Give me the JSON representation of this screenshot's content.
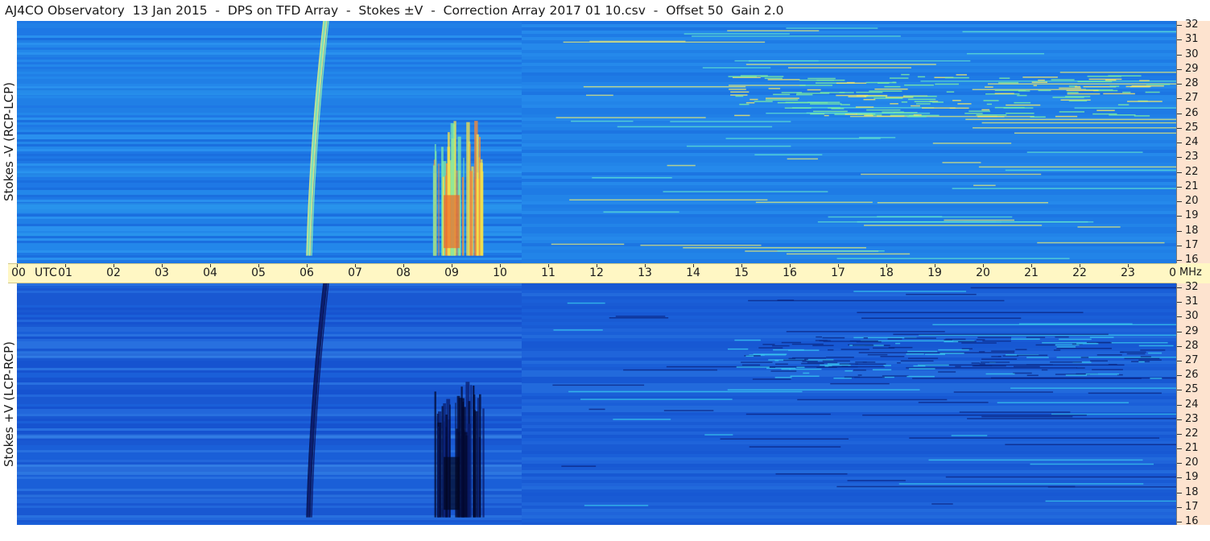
{
  "header": {
    "title": "AJ4CO Observatory  13 Jan 2015  -  DPS on TFD Array  -  Stokes ±V  -  Correction Array 2017 01 10.csv  -  Offset 50  Gain 2.0"
  },
  "panels": {
    "top_label": "Stokes -V (RCP-LCP)",
    "bottom_label": "Stokes +V (LCP-RCP)"
  },
  "time_axis": {
    "unit_label": "UTC",
    "ticks": [
      "00",
      "01",
      "02",
      "03",
      "04",
      "05",
      "06",
      "07",
      "08",
      "09",
      "10",
      "11",
      "12",
      "13",
      "14",
      "15",
      "16",
      "17",
      "18",
      "19",
      "20",
      "21",
      "22",
      "23",
      "00"
    ]
  },
  "freq_axis": {
    "unit_label": "MHz",
    "ticks": [
      "32",
      "31",
      "30",
      "29",
      "28",
      "27",
      "26",
      "25",
      "24",
      "23",
      "22",
      "21",
      "20",
      "19",
      "18",
      "17",
      "16"
    ]
  },
  "colors": {
    "top_background": "#1f7ee6",
    "bottom_background": "#1a5fd8",
    "time_bar": "#fff7c4",
    "freq_bar": "#fde3cf"
  },
  "chart_data": {
    "type": "heatmap",
    "title": "AJ4CO Observatory  13 Jan 2015  -  DPS on TFD Array  -  Stokes ±V  -  Correction Array 2017 01 10.csv  -  Offset 50  Gain 2.0",
    "xlabel": "UTC",
    "ylabel": "MHz",
    "xlim": [
      0,
      24
    ],
    "ylim": [
      16,
      32
    ],
    "panels": [
      {
        "name": "Stokes -V (RCP-LCP)",
        "features": [
          {
            "kind": "drift_burst",
            "t_start": 6.0,
            "t_end": 6.35,
            "f_low": 16.5,
            "f_high": 32
          },
          {
            "kind": "emission_storm",
            "t_start": 8.6,
            "t_end": 9.7,
            "f_low": 16.5,
            "f_high": 25.5
          },
          {
            "kind": "band_activity",
            "t_start": 14.7,
            "t_end": 23.5,
            "f_low": 25.7,
            "f_high": 28.5
          }
        ]
      },
      {
        "name": "Stokes +V (LCP-RCP)",
        "features": [
          {
            "kind": "drift_burst",
            "t_start": 6.0,
            "t_end": 6.35,
            "f_low": 16.5,
            "f_high": 32
          },
          {
            "kind": "emission_storm",
            "t_start": 8.6,
            "t_end": 9.7,
            "f_low": 16.5,
            "f_high": 25.5
          },
          {
            "kind": "band_activity",
            "t_start": 14.7,
            "t_end": 23.5,
            "f_low": 25.7,
            "f_high": 28.5
          }
        ]
      }
    ]
  }
}
